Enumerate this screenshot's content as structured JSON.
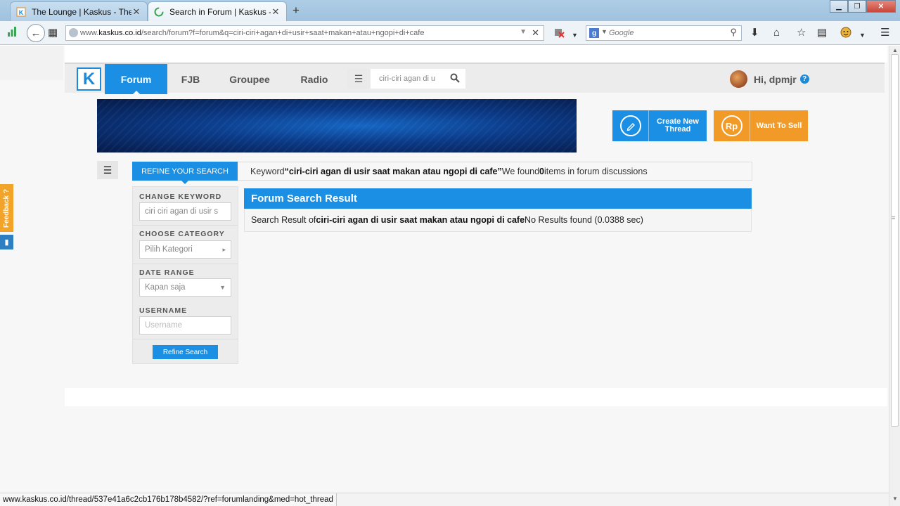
{
  "browser": {
    "tabs": [
      {
        "title": "The Lounge | Kaskus - The ...",
        "active": false
      },
      {
        "title": "Search in Forum | Kaskus - ...",
        "active": true
      }
    ],
    "url_prefix": "www.",
    "url_domain": "kaskus.co.id",
    "url_rest": "/search/forum?f=forum&q=ciri-ciri+agan+di+usir+saat+makan+atau+ngopi+di+cafe",
    "search_placeholder": "Google",
    "status_url": "www.kaskus.co.id/thread/537e41a6c2cb176b178b4582/?ref=forumlanding&med=hot_thread"
  },
  "header": {
    "logo": "K",
    "nav": [
      "Forum",
      "FJB",
      "Groupee",
      "Radio"
    ],
    "active_nav": "Forum",
    "search_query": "ciri-ciri agan di u",
    "greeting": "Hi, dpmjr",
    "help": "?"
  },
  "actions": {
    "create_thread": "Create New Thread",
    "want_to_sell": "Want To Sell",
    "rp_icon": "Rp"
  },
  "search": {
    "refine_tab": "REFINE YOUR SEARCH",
    "keyword_prefix": "Keyword ",
    "keyword": "“ciri-ciri agan di usir saat makan atau ngopi di cafe”",
    "found_prefix": " We found ",
    "found_count": "0",
    "found_suffix": " items in forum discussions"
  },
  "sidebar": {
    "change_keyword_label": "CHANGE KEYWORD",
    "keyword_value": "ciri ciri agan di usir s",
    "choose_category_label": "CHOOSE CATEGORY",
    "category_value": "Pilih Kategori",
    "date_range_label": "DATE RANGE",
    "date_value": "Kapan saja",
    "username_label": "USERNAME",
    "username_placeholder": "Username",
    "refine_button": "Refine Search"
  },
  "results": {
    "title": "Forum Search Result",
    "prefix": "Search Result of ",
    "query": "ciri-ciri agan di usir saat makan atau ngopi di cafe",
    "suffix": " No Results found (0.0388 sec)"
  },
  "feedback": {
    "label": "Feedback ?"
  },
  "colors": {
    "primary": "#1a8fe3",
    "orange": "#f29a28"
  }
}
